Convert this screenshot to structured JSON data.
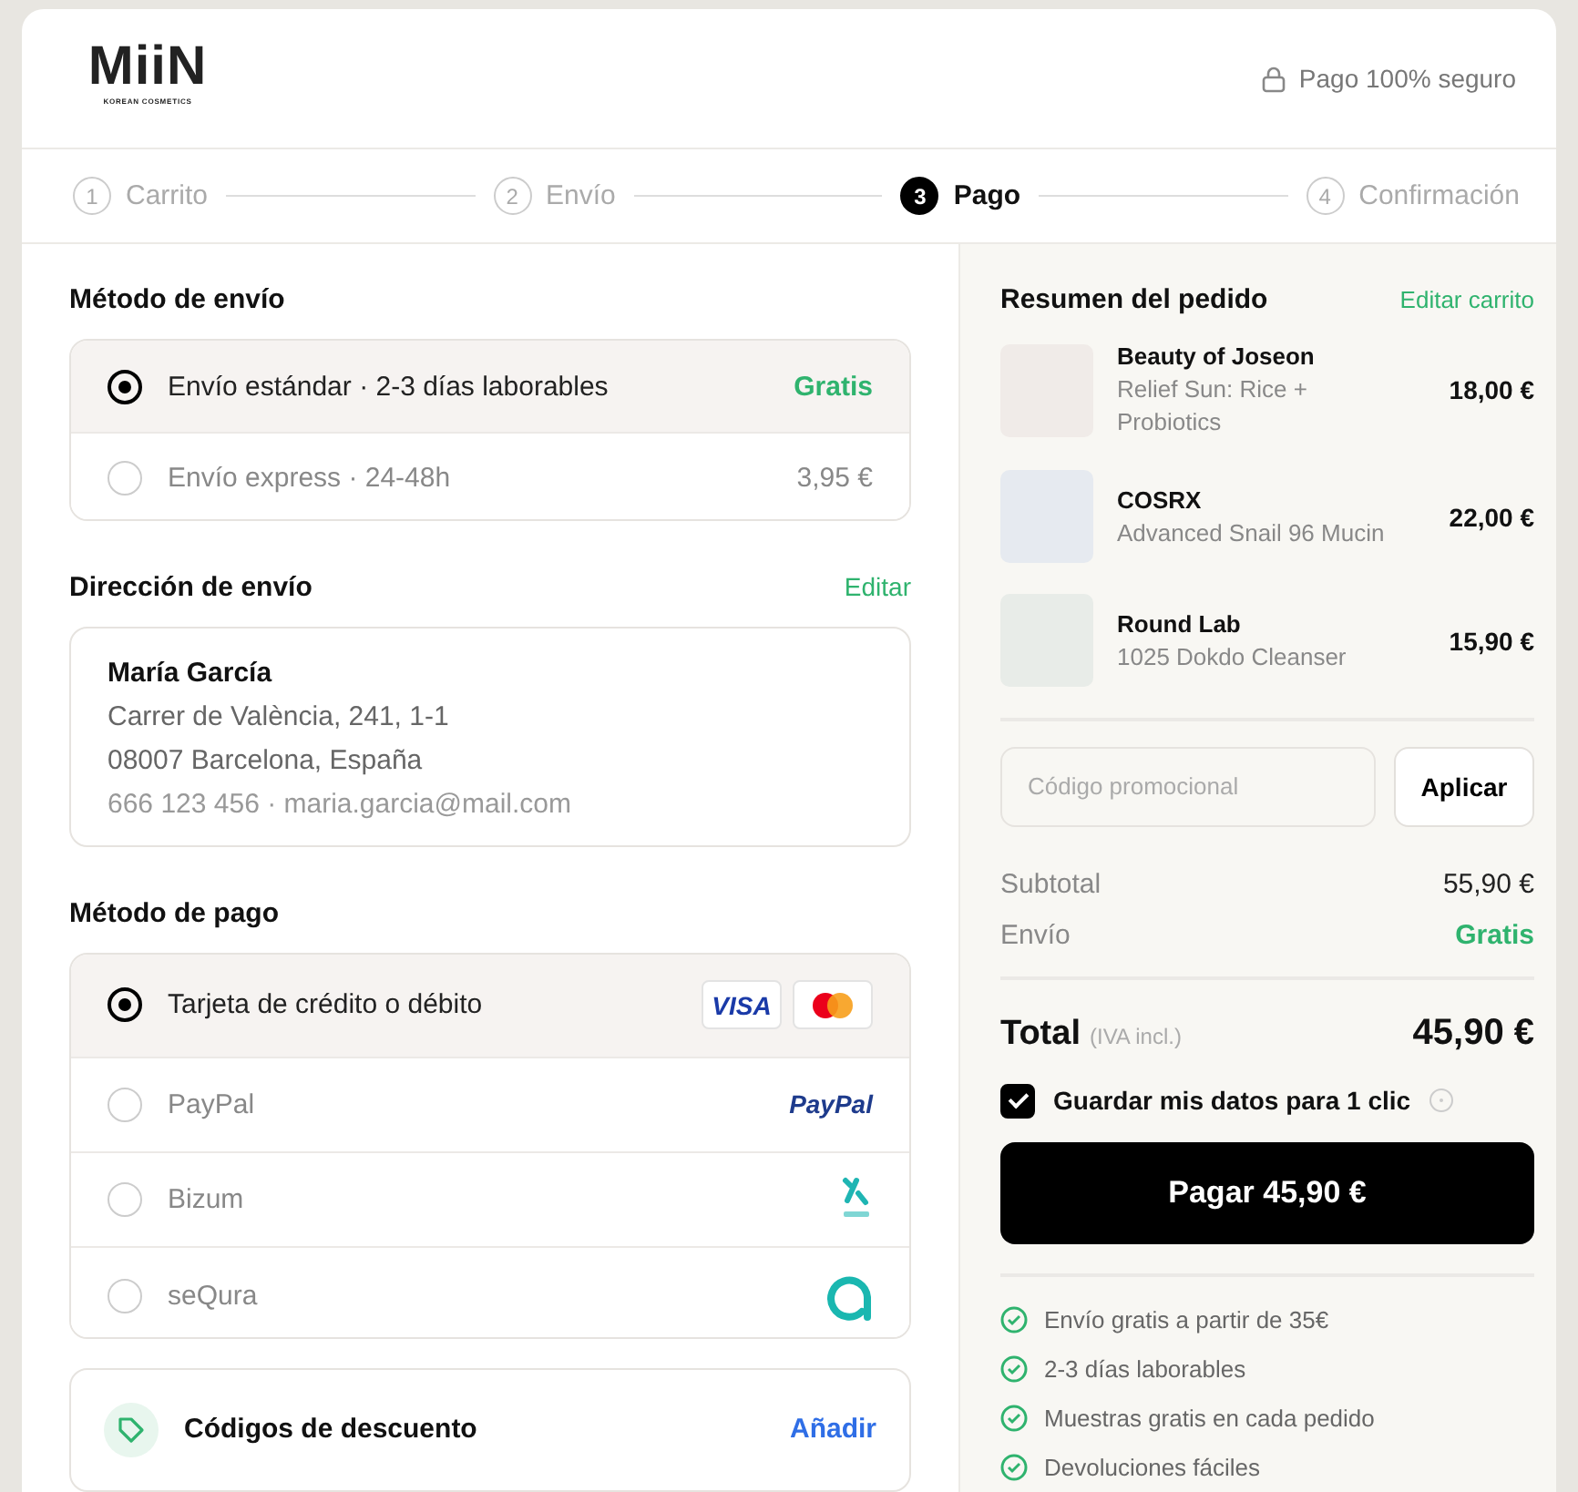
{
  "header": {
    "logo": {
      "name": "MiiN",
      "tagline": "KOREAN COSMETICS"
    },
    "secure_label": "Pago 100% seguro"
  },
  "steps": [
    {
      "number": "1",
      "label": "Carrito",
      "selected": false
    },
    {
      "number": "2",
      "label": "Envío",
      "selected": false
    },
    {
      "number": "3",
      "label": "Pago",
      "selected": true
    },
    {
      "number": "4",
      "label": "Confirmación",
      "selected": false
    }
  ],
  "shipping": {
    "title": "Método de envío",
    "options": [
      {
        "label": "Envío estándar · 2-3 días laborables",
        "price": "Gratis",
        "kind": "free",
        "selected": true
      },
      {
        "label": "Envío express · 24-48h",
        "price": "3,95 €",
        "kind": "paid",
        "selected": false
      }
    ]
  },
  "address": {
    "title": "Dirección de envío",
    "edit_link": "Editar",
    "name": "María García",
    "lines": [
      "Carrer de València, 241, 1-1",
      "08007 Barcelona, España"
    ],
    "contact": "666 123 456 · maria.garcia@mail.com"
  },
  "payment": {
    "title": "Método de pago",
    "methods": [
      {
        "label": "Tarjeta de crédito o débito",
        "kind": "cards",
        "logo_text": "VISA",
        "selected": true
      },
      {
        "label": "PayPal",
        "kind": "paypal",
        "logo_text": "PayPal",
        "selected": false
      },
      {
        "label": "Bizum",
        "kind": "bizum",
        "selected": false
      },
      {
        "label": "seQura",
        "kind": "sequra",
        "selected": false
      }
    ]
  },
  "discount": {
    "label": "Códigos de descuento",
    "action": "Añadir"
  },
  "summary": {
    "title": "Resumen del pedido",
    "edit_link": "Editar carrito",
    "items": [
      {
        "brand": "Beauty of Joseon",
        "name": "Relief Sun: Rice + Probiotics",
        "price": "18,00 €",
        "color": "#f0ebe8"
      },
      {
        "brand": "COSRX",
        "name": "Advanced Snail 96 Mucin",
        "price": "22,00 €",
        "color": "#e6eaf0"
      },
      {
        "brand": "Round Lab",
        "name": "1025 Dokdo Cleanser",
        "price": "15,90 €",
        "color": "#e8ece8"
      }
    ],
    "promo": {
      "placeholder": "Código promocional",
      "button": "Aplicar"
    },
    "rows": [
      {
        "label": "Subtotal",
        "value": "55,90 €",
        "kind": "normal"
      },
      {
        "label": "Envío",
        "value": "Gratis",
        "kind": "free"
      }
    ],
    "total": {
      "label": "Total",
      "note": "(IVA incl.)",
      "value": "45,90 €"
    },
    "save": {
      "label": "Guardar mis datos para 1 clic",
      "checked": true
    },
    "pay_button": "Pagar 45,90 €",
    "benefits": [
      "Envío gratis a partir de 35€",
      "2-3 días laborables",
      "Muestras gratis en cada pedido",
      "Devoluciones fáciles"
    ]
  }
}
